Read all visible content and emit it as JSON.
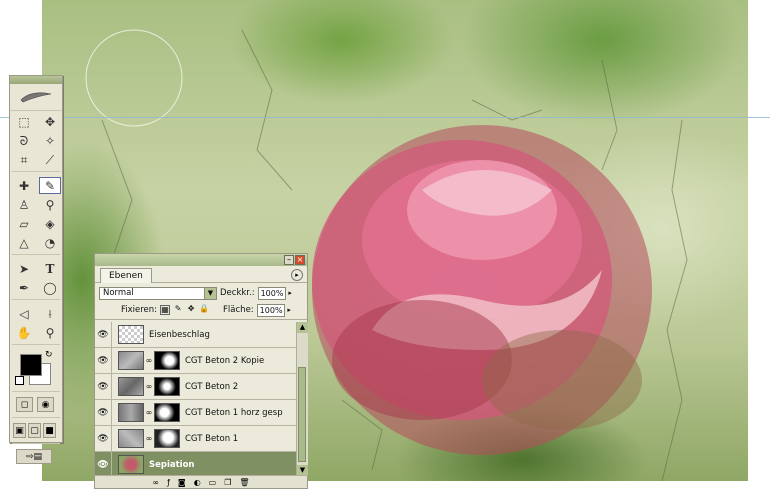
{
  "layers_panel": {
    "tab_label": "Ebenen",
    "blend_mode": "Normal",
    "opacity_label": "Deckkr.:",
    "opacity_value": "100%",
    "lock_label": "Fixieren:",
    "fill_label": "Fläche:",
    "fill_value": "100%",
    "layers": [
      {
        "name": "Eisenbeschlag",
        "visible": true,
        "has_mask": false,
        "selected": false
      },
      {
        "name": "CGT Beton 2 Kopie",
        "visible": true,
        "has_mask": true,
        "selected": false
      },
      {
        "name": "CGT Beton 2",
        "visible": true,
        "has_mask": true,
        "selected": false
      },
      {
        "name": "CGT Beton 1 horz gesp",
        "visible": true,
        "has_mask": true,
        "selected": false
      },
      {
        "name": "CGT Beton 1",
        "visible": true,
        "has_mask": true,
        "selected": false
      },
      {
        "name": "Sepiation",
        "visible": true,
        "has_mask": false,
        "selected": true
      }
    ]
  },
  "toolbox": {
    "tools": [
      "marquee-tool",
      "move-tool",
      "lasso-tool",
      "magic-wand-tool",
      "crop-tool",
      "slice-tool",
      "healing-brush-tool",
      "brush-tool",
      "clone-stamp-tool",
      "history-brush-tool",
      "eraser-tool",
      "paint-bucket-tool",
      "blur-tool",
      "dodge-tool",
      "path-selection-tool",
      "type-tool",
      "pen-tool",
      "shape-tool",
      "notes-tool",
      "eyedropper-tool",
      "hand-tool",
      "zoom-tool"
    ],
    "active_tool": "brush-tool",
    "foreground_color": "#000000",
    "background_color": "#ffffff"
  },
  "colors": {
    "panel_bg": "#eceadb",
    "accent": "#a9b98a",
    "selected_layer": "#7f9163"
  }
}
